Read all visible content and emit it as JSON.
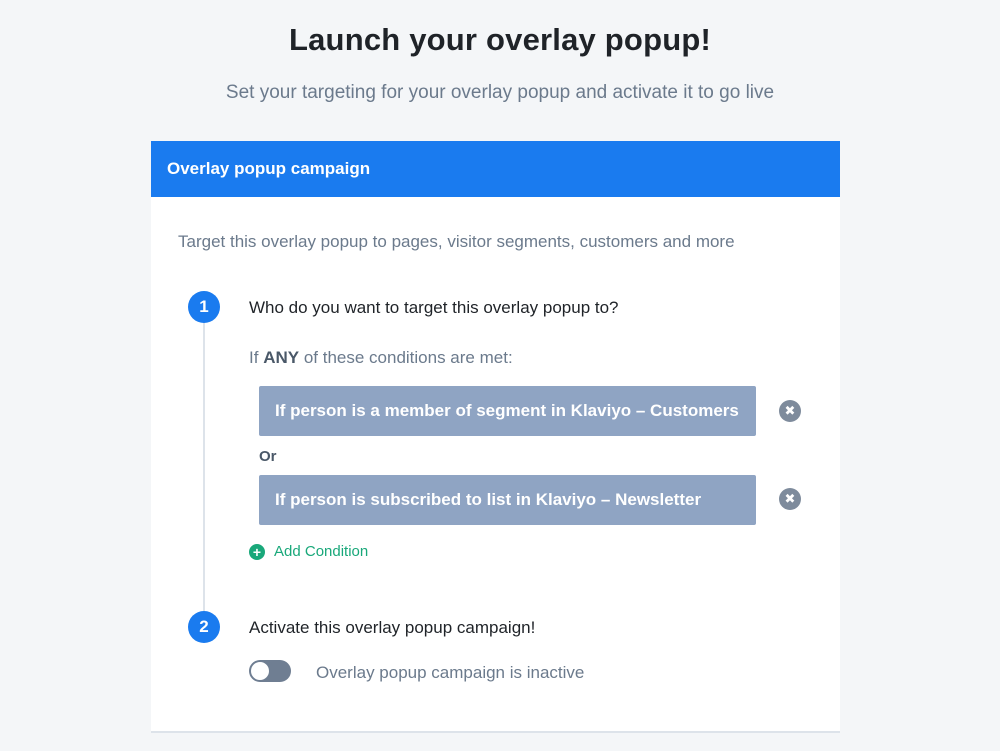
{
  "page": {
    "title": "Launch your overlay popup!",
    "subtitle": "Set your targeting for your overlay popup and activate it to go live"
  },
  "card": {
    "header": "Overlay popup campaign",
    "description": "Target this overlay popup to pages, visitor segments, customers and more"
  },
  "step1": {
    "number": "1",
    "title": "Who do you want to target this overlay popup to?",
    "intro_prefix": "If",
    "intro_keyword": "ANY",
    "intro_suffix": "of these conditions are met:",
    "conditions": [
      {
        "label": "If person is a member of segment in Klaviyo – Customers",
        "remove_icon": "✖"
      },
      {
        "label": "If person is subscribed to list in Klaviyo – Newsletter",
        "remove_icon": "✖"
      }
    ],
    "or_label": "Or",
    "add_condition_icon": "+",
    "add_condition_label": "Add Condition"
  },
  "step2": {
    "number": "2",
    "title": "Activate this overlay popup campaign!",
    "toggle_state": "off",
    "toggle_label": "Overlay popup campaign is inactive"
  },
  "colors": {
    "accent": "#1a7bef",
    "condition_bg": "#8fa4c3",
    "add_green": "#19a87a"
  }
}
